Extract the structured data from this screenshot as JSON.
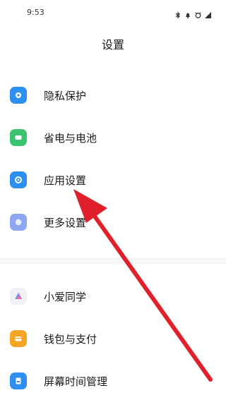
{
  "status_bar": {
    "time": "9:53"
  },
  "header": {
    "title": "设置"
  },
  "items_group1": [
    {
      "label": "隐私保护",
      "color": "#2f8ff0",
      "icon": "privacy-icon"
    },
    {
      "label": "省电与电池",
      "color": "#3bc46f",
      "icon": "battery-icon"
    },
    {
      "label": "应用设置",
      "color": "#2f8ff0",
      "icon": "app-settings-icon"
    },
    {
      "label": "更多设置",
      "color": "#8fa6f2",
      "icon": "more-settings-icon"
    }
  ],
  "items_group2": [
    {
      "label": "小爱同学",
      "color": "#f0f0f5",
      "icon": "assistant-icon"
    },
    {
      "label": "钱包与支付",
      "color": "#f5a524",
      "icon": "wallet-icon"
    },
    {
      "label": "屏幕时间管理",
      "color": "#2f8ff0",
      "icon": "screen-time-icon"
    }
  ],
  "annotation_color": "#e0202a"
}
